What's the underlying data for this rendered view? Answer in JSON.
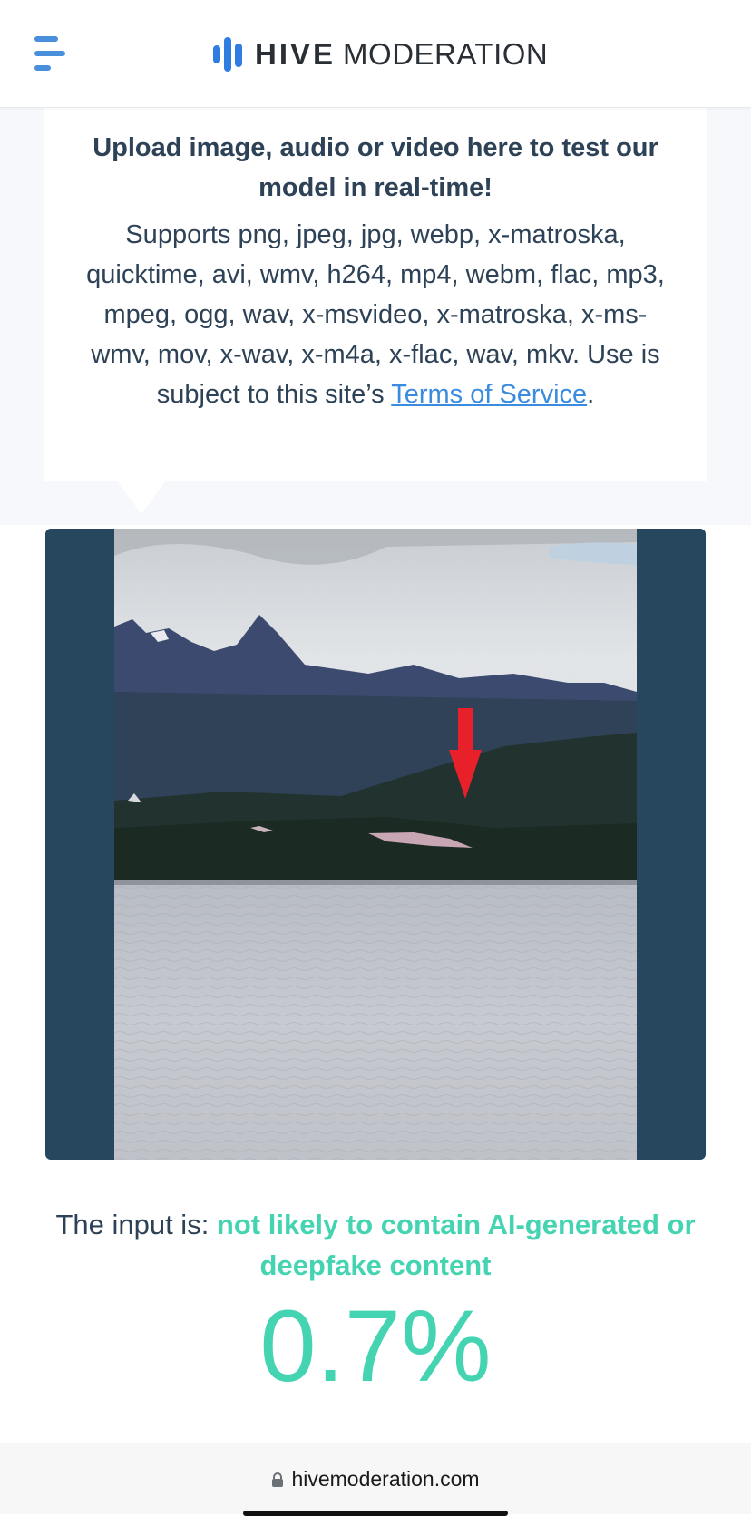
{
  "header": {
    "menu_icon": "hamburger-menu-icon",
    "logo_icon": "hive-bars-logo",
    "logo_brand": "HIVE",
    "logo_product": "MODERATION",
    "accent_color": "#2f7de1"
  },
  "upload": {
    "title": "Upload image, audio or video here to test our model in real-time!",
    "description": "Supports png, jpeg, jpg, webp, x-matroska, quicktime, avi, wmv, h264, mp4, webm, flac, mp3, mpeg, ogg, wav, x-msvideo, x-matroska, x-ms-wmv, mov, x-wav, x-m4a, x-flac, wav, mkv. Use is subject to this site’s",
    "terms_link": "Terms of Service",
    "period": "."
  },
  "preview": {
    "frame_color": "#27475f",
    "annotation_icon": "red-down-arrow"
  },
  "result": {
    "prefix": "The input is: ",
    "verdict": "not likely to contain AI-generated or deepfake content",
    "score": "0.7%",
    "verdict_color": "#45d4b2"
  },
  "browser": {
    "url": "hivemoderation.com",
    "lock_icon": "lock-icon"
  }
}
